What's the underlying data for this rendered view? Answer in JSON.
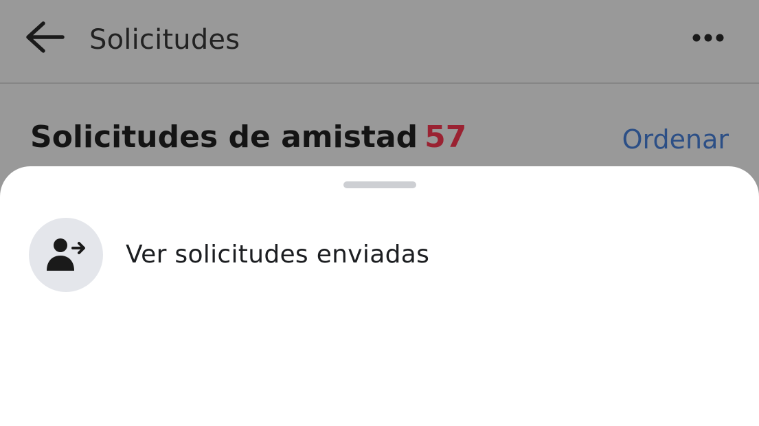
{
  "app_bar": {
    "back_icon": "arrow-left-icon",
    "title": "Solicitudes",
    "more_icon": "more-horizontal-icon"
  },
  "section": {
    "title": "Solicitudes de amistad",
    "count": "57",
    "sort_label": "Ordenar"
  },
  "bottom_sheet": {
    "items": [
      {
        "icon": "person-arrow-icon",
        "label": "Ver solicitudes enviadas"
      }
    ]
  },
  "colors": {
    "overlay_background": "#999999",
    "count_red": "#9a2232",
    "link_blue": "#2c4f86",
    "sheet_background": "#ffffff",
    "icon_circle": "#e4e6eb",
    "drag_handle": "#cdcfd3"
  }
}
